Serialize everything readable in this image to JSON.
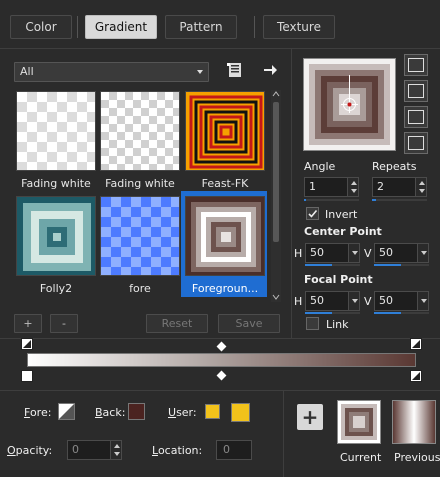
{
  "tabs": [
    {
      "label": "Color",
      "active": false
    },
    {
      "label": "Gradient",
      "active": true
    },
    {
      "label": "Pattern",
      "active": false
    },
    {
      "label": "Texture",
      "active": false
    }
  ],
  "filter": {
    "value": "All"
  },
  "presets": [
    {
      "name": "Fading white",
      "selected": false
    },
    {
      "name": "Fading white",
      "selected": false
    },
    {
      "name": "Feast-FK",
      "selected": false
    },
    {
      "name": "Folly2",
      "selected": false
    },
    {
      "name": "fore",
      "selected": false
    },
    {
      "name": "Foregroun...",
      "selected": true
    }
  ],
  "list_buttons": {
    "add": "+",
    "remove": "-",
    "reset": "Reset",
    "save": "Save"
  },
  "angle": {
    "label": "Angle",
    "value": "1"
  },
  "repeats": {
    "label": "Repeats",
    "value": "2"
  },
  "invert": {
    "label": "Invert",
    "checked": true
  },
  "center_point": {
    "label": "Center Point",
    "h_label": "H",
    "h": "50",
    "v_label": "V",
    "v": "50"
  },
  "focal_point": {
    "label": "Focal Point",
    "h_label": "H",
    "h": "50",
    "v_label": "V",
    "v": "50"
  },
  "link": {
    "label": "Link",
    "checked": false
  },
  "bottom": {
    "fore_label": "Fore:",
    "back_label": "Back:",
    "user_label": "User:",
    "opacity_label": "Opacity:",
    "opacity_value": "0",
    "location_label": "Location:",
    "location_value": "0",
    "current_label": "Current",
    "previous_label": "Previous"
  },
  "colors": {
    "accent": "#1f6dd2",
    "user_color": "#f2c21b",
    "back_color": "#4b2320",
    "gradient_end": "#5a3833"
  }
}
